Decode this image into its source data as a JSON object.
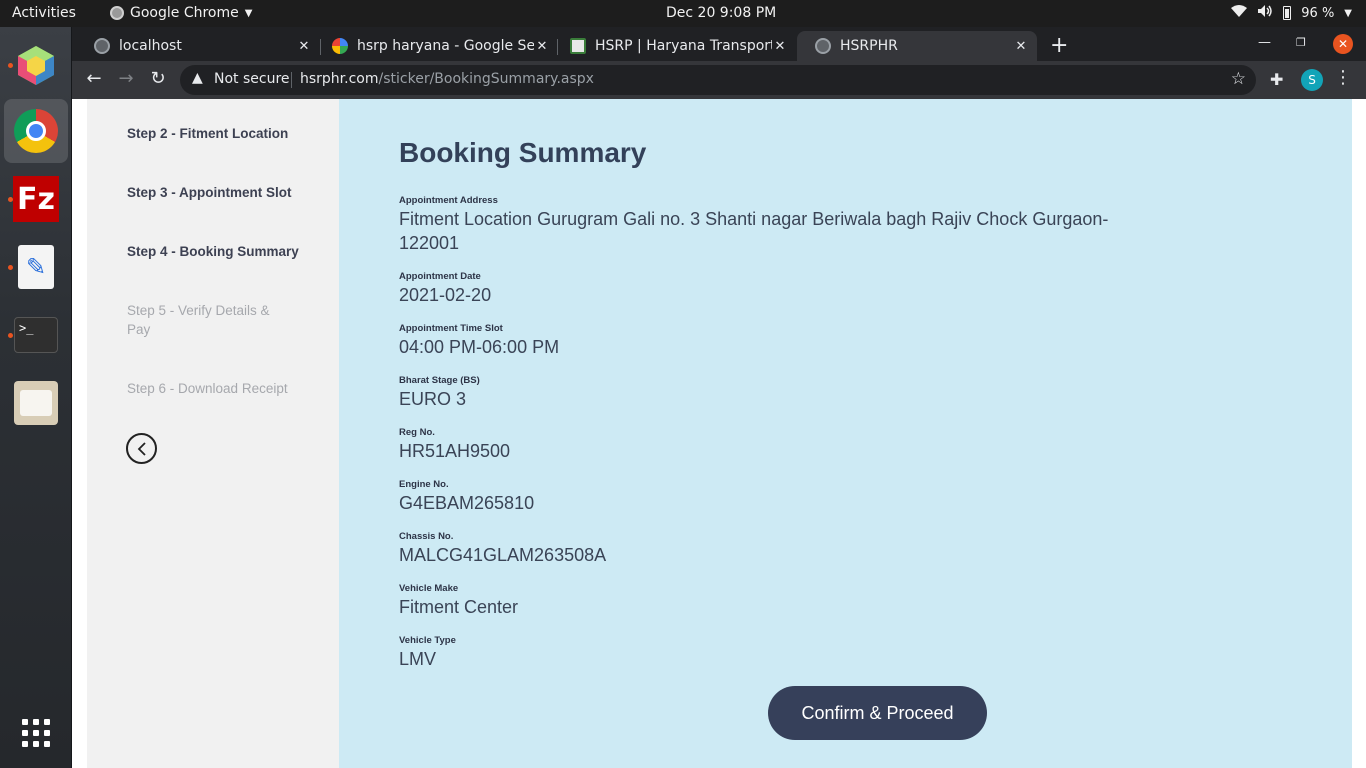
{
  "topbar": {
    "activities": "Activities",
    "app_name": "Google Chrome",
    "clock": "Dec 20  9:08 PM",
    "battery": "96 %"
  },
  "dock": {
    "items": [
      "netbeans-ide",
      "google-chrome",
      "filezilla",
      "text-editor",
      "terminal",
      "files",
      "show-applications"
    ]
  },
  "tabs": [
    {
      "title": "localhost",
      "favicon": "globe-icon",
      "active": false
    },
    {
      "title": "hsrp haryana - Google Sea",
      "favicon": "google-icon",
      "active": false
    },
    {
      "title": "HSRP | Haryana Transport",
      "favicon": "haryana-emblem-icon",
      "active": false
    },
    {
      "title": "HSRPHR",
      "favicon": "globe-icon",
      "active": true
    }
  ],
  "toolbar": {
    "security_label": "Not secure",
    "url_host": "hsrphr.com",
    "url_path": "/sticker/BookingSummary.aspx",
    "avatar_letter": "S"
  },
  "sidebar": {
    "steps": [
      {
        "label": "Step 2 - Fitment Location",
        "state": "done"
      },
      {
        "label": "Step 3 - Appointment Slot",
        "state": "done"
      },
      {
        "label": "Step 4 - Booking Summary",
        "state": "current"
      },
      {
        "label": "Step 5 - Verify Details & Pay",
        "state": "pending"
      },
      {
        "label": "Step 6 - Download Receipt",
        "state": "pending"
      }
    ]
  },
  "summary": {
    "title": "Booking Summary",
    "fields": [
      {
        "label": "Appointment Address",
        "value": "Fitment Location Gurugram Gali no. 3 Shanti nagar Beriwala bagh Rajiv Chock Gurgaon-122001"
      },
      {
        "label": "Appointment Date",
        "value": "2021-02-20"
      },
      {
        "label": "Appointment Time Slot",
        "value": "04:00 PM-06:00 PM"
      },
      {
        "label": "Bharat Stage (BS)",
        "value": "EURO 3"
      },
      {
        "label": "Reg No.",
        "value": "HR51AH9500"
      },
      {
        "label": "Engine No.",
        "value": "G4EBAM265810"
      },
      {
        "label": "Chassis No.",
        "value": "MALCG41GLAM263508A"
      },
      {
        "label": "Vehicle Make",
        "value": "Fitment Center"
      },
      {
        "label": "Vehicle Type",
        "value": "LMV"
      }
    ],
    "confirm_label": "Confirm & Proceed"
  },
  "colors": {
    "main_bg": "#cdeaf4",
    "sidebar_bg": "#f1f1f1",
    "button_bg": "#36405a",
    "title_color": "#334159",
    "ubuntu_accent": "#e95420"
  }
}
